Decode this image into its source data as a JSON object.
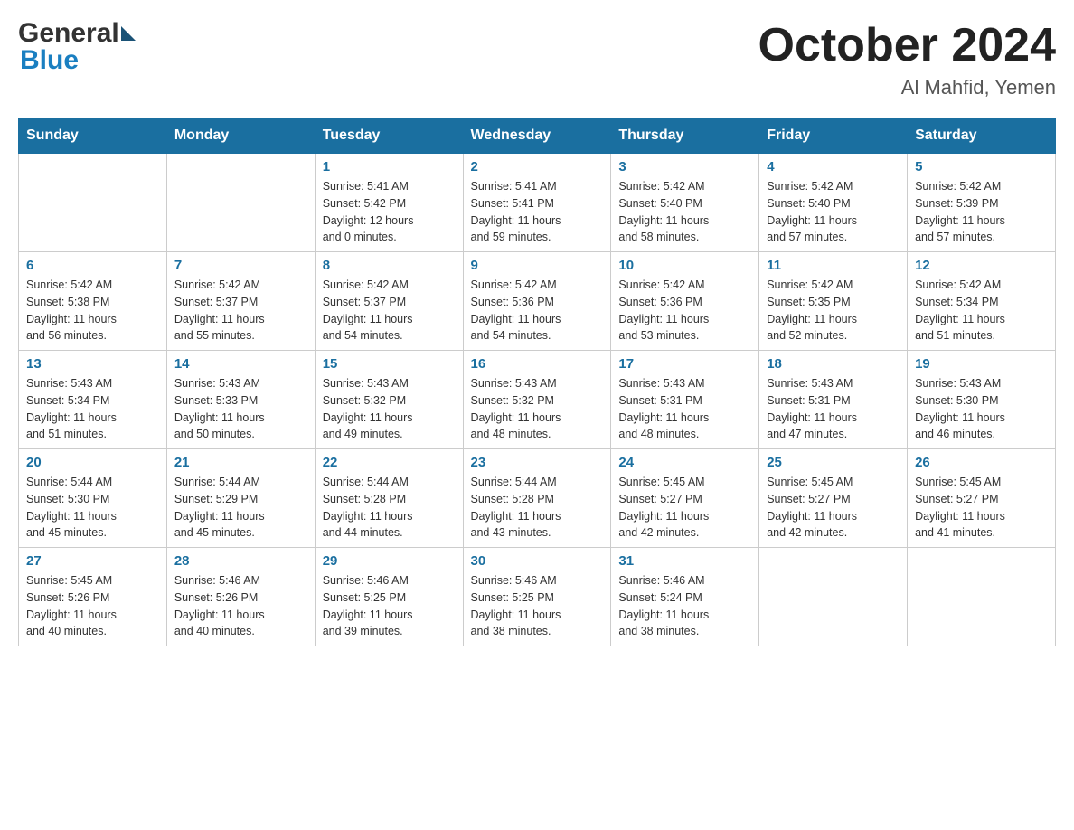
{
  "header": {
    "logo_general": "General",
    "logo_blue": "Blue",
    "month_title": "October 2024",
    "location": "Al Mahfid, Yemen"
  },
  "days_of_week": [
    "Sunday",
    "Monday",
    "Tuesday",
    "Wednesday",
    "Thursday",
    "Friday",
    "Saturday"
  ],
  "weeks": [
    [
      {
        "day": "",
        "info": ""
      },
      {
        "day": "",
        "info": ""
      },
      {
        "day": "1",
        "info": "Sunrise: 5:41 AM\nSunset: 5:42 PM\nDaylight: 12 hours\nand 0 minutes."
      },
      {
        "day": "2",
        "info": "Sunrise: 5:41 AM\nSunset: 5:41 PM\nDaylight: 11 hours\nand 59 minutes."
      },
      {
        "day": "3",
        "info": "Sunrise: 5:42 AM\nSunset: 5:40 PM\nDaylight: 11 hours\nand 58 minutes."
      },
      {
        "day": "4",
        "info": "Sunrise: 5:42 AM\nSunset: 5:40 PM\nDaylight: 11 hours\nand 57 minutes."
      },
      {
        "day": "5",
        "info": "Sunrise: 5:42 AM\nSunset: 5:39 PM\nDaylight: 11 hours\nand 57 minutes."
      }
    ],
    [
      {
        "day": "6",
        "info": "Sunrise: 5:42 AM\nSunset: 5:38 PM\nDaylight: 11 hours\nand 56 minutes."
      },
      {
        "day": "7",
        "info": "Sunrise: 5:42 AM\nSunset: 5:37 PM\nDaylight: 11 hours\nand 55 minutes."
      },
      {
        "day": "8",
        "info": "Sunrise: 5:42 AM\nSunset: 5:37 PM\nDaylight: 11 hours\nand 54 minutes."
      },
      {
        "day": "9",
        "info": "Sunrise: 5:42 AM\nSunset: 5:36 PM\nDaylight: 11 hours\nand 54 minutes."
      },
      {
        "day": "10",
        "info": "Sunrise: 5:42 AM\nSunset: 5:36 PM\nDaylight: 11 hours\nand 53 minutes."
      },
      {
        "day": "11",
        "info": "Sunrise: 5:42 AM\nSunset: 5:35 PM\nDaylight: 11 hours\nand 52 minutes."
      },
      {
        "day": "12",
        "info": "Sunrise: 5:42 AM\nSunset: 5:34 PM\nDaylight: 11 hours\nand 51 minutes."
      }
    ],
    [
      {
        "day": "13",
        "info": "Sunrise: 5:43 AM\nSunset: 5:34 PM\nDaylight: 11 hours\nand 51 minutes."
      },
      {
        "day": "14",
        "info": "Sunrise: 5:43 AM\nSunset: 5:33 PM\nDaylight: 11 hours\nand 50 minutes."
      },
      {
        "day": "15",
        "info": "Sunrise: 5:43 AM\nSunset: 5:32 PM\nDaylight: 11 hours\nand 49 minutes."
      },
      {
        "day": "16",
        "info": "Sunrise: 5:43 AM\nSunset: 5:32 PM\nDaylight: 11 hours\nand 48 minutes."
      },
      {
        "day": "17",
        "info": "Sunrise: 5:43 AM\nSunset: 5:31 PM\nDaylight: 11 hours\nand 48 minutes."
      },
      {
        "day": "18",
        "info": "Sunrise: 5:43 AM\nSunset: 5:31 PM\nDaylight: 11 hours\nand 47 minutes."
      },
      {
        "day": "19",
        "info": "Sunrise: 5:43 AM\nSunset: 5:30 PM\nDaylight: 11 hours\nand 46 minutes."
      }
    ],
    [
      {
        "day": "20",
        "info": "Sunrise: 5:44 AM\nSunset: 5:30 PM\nDaylight: 11 hours\nand 45 minutes."
      },
      {
        "day": "21",
        "info": "Sunrise: 5:44 AM\nSunset: 5:29 PM\nDaylight: 11 hours\nand 45 minutes."
      },
      {
        "day": "22",
        "info": "Sunrise: 5:44 AM\nSunset: 5:28 PM\nDaylight: 11 hours\nand 44 minutes."
      },
      {
        "day": "23",
        "info": "Sunrise: 5:44 AM\nSunset: 5:28 PM\nDaylight: 11 hours\nand 43 minutes."
      },
      {
        "day": "24",
        "info": "Sunrise: 5:45 AM\nSunset: 5:27 PM\nDaylight: 11 hours\nand 42 minutes."
      },
      {
        "day": "25",
        "info": "Sunrise: 5:45 AM\nSunset: 5:27 PM\nDaylight: 11 hours\nand 42 minutes."
      },
      {
        "day": "26",
        "info": "Sunrise: 5:45 AM\nSunset: 5:27 PM\nDaylight: 11 hours\nand 41 minutes."
      }
    ],
    [
      {
        "day": "27",
        "info": "Sunrise: 5:45 AM\nSunset: 5:26 PM\nDaylight: 11 hours\nand 40 minutes."
      },
      {
        "day": "28",
        "info": "Sunrise: 5:46 AM\nSunset: 5:26 PM\nDaylight: 11 hours\nand 40 minutes."
      },
      {
        "day": "29",
        "info": "Sunrise: 5:46 AM\nSunset: 5:25 PM\nDaylight: 11 hours\nand 39 minutes."
      },
      {
        "day": "30",
        "info": "Sunrise: 5:46 AM\nSunset: 5:25 PM\nDaylight: 11 hours\nand 38 minutes."
      },
      {
        "day": "31",
        "info": "Sunrise: 5:46 AM\nSunset: 5:24 PM\nDaylight: 11 hours\nand 38 minutes."
      },
      {
        "day": "",
        "info": ""
      },
      {
        "day": "",
        "info": ""
      }
    ]
  ]
}
